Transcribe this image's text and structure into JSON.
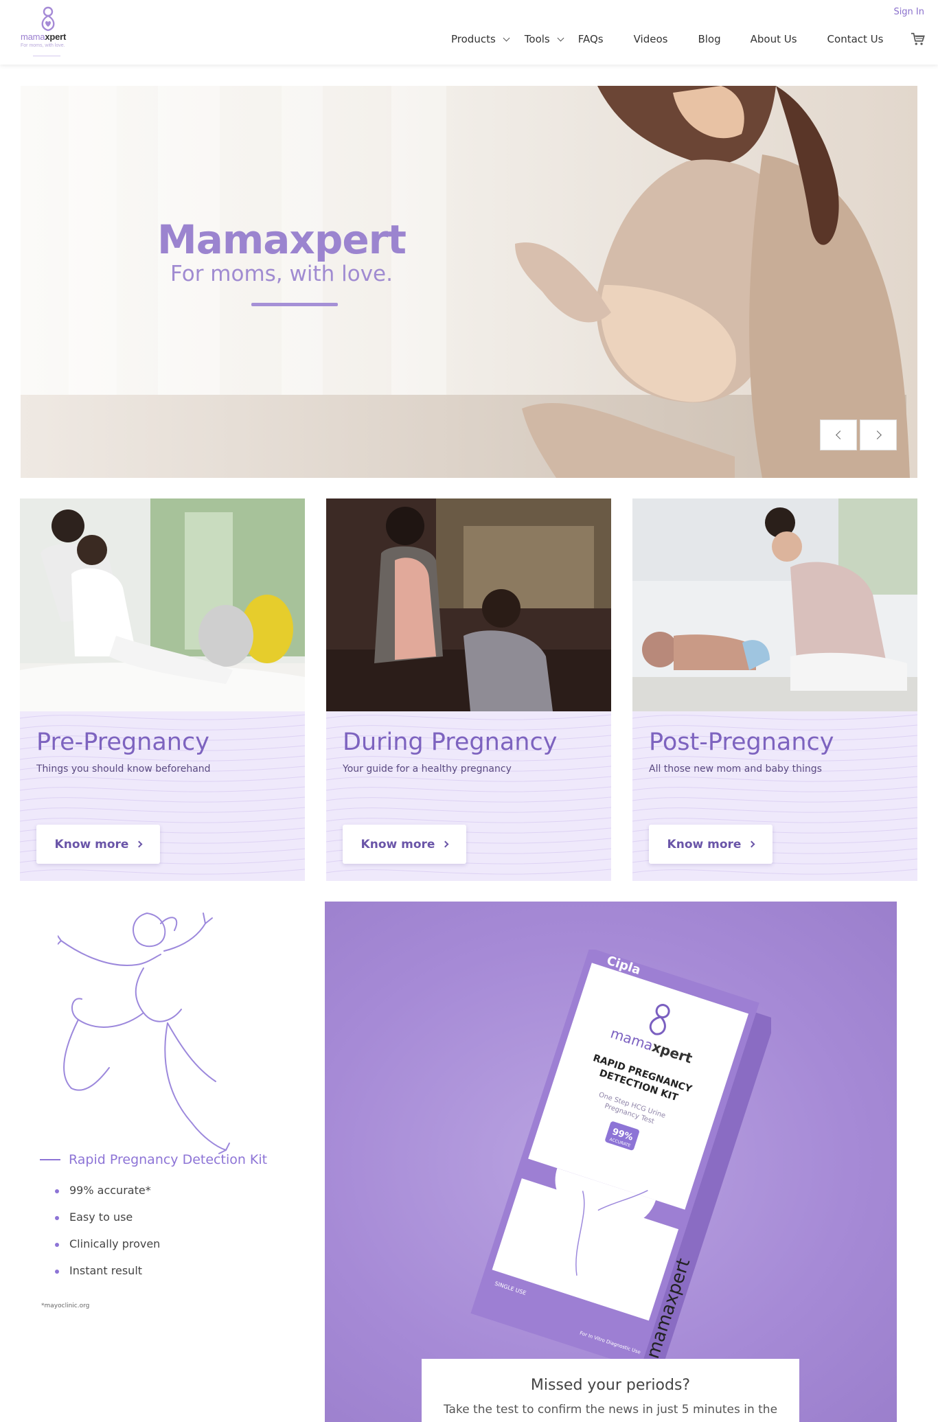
{
  "header": {
    "logo_word_light": "mama",
    "logo_word_bold": "xpert",
    "logo_tagline": "For moms, with love.",
    "signin_label": "Sign In",
    "nav": [
      "Products",
      "Tools",
      "FAQs",
      "Videos",
      "Blog",
      "About Us",
      "Contact Us"
    ],
    "cart_icon": "cart-icon"
  },
  "hero": {
    "title": "Mamaxpert",
    "subtitle": "For moms, with love.",
    "prev_icon": "chevron-left-icon",
    "next_icon": "chevron-right-icon"
  },
  "cards": [
    {
      "title": "Pre-Pregnancy",
      "subtitle": "Things you should know beforehand",
      "button": "Know more"
    },
    {
      "title": "During Pregnancy",
      "subtitle": "Your guide for a healthy pregnancy",
      "button": "Know more"
    },
    {
      "title": "Post-Pregnancy",
      "subtitle": "All those new mom and baby things",
      "button": "Know more"
    }
  ],
  "kit": {
    "title": "Rapid Pregnancy Detection Kit",
    "features": [
      "99% accurate*",
      "Easy to use",
      "Clinically proven",
      "Instant result"
    ],
    "footnote": "*mayoclinic.org"
  },
  "box": {
    "brand": "Cipla",
    "logo_light": "mama",
    "logo_bold": "xpert",
    "line1": "RAPID PREGNANCY",
    "line2": "DETECTION KIT",
    "desc1": "One Step HCG Urine",
    "desc2": "Pregnancy Test",
    "badge_value": "99%",
    "badge_label": "ACCURATE",
    "side_text": "mamaxpert",
    "single_use": "SINGLE USE",
    "ivd": "For In Vitro Diagnostic Use"
  },
  "missed": {
    "title": "Missed your periods?",
    "text": "Take the test to confirm the news in just 5 minutes in the"
  },
  "colors": {
    "brand_purple": "#8d74d6",
    "card_bg": "#efe9fb",
    "panel_bg": "#a68ad6"
  }
}
